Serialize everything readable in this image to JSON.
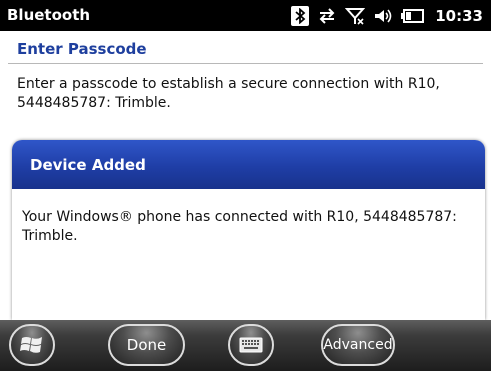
{
  "status_bar": {
    "app_title": "Bluetooth",
    "time": "10:33",
    "icons": [
      "bluetooth-icon",
      "sync-icon",
      "no-signal-icon",
      "speaker-icon",
      "battery-icon"
    ]
  },
  "page": {
    "heading": "Enter Passcode",
    "description": "Enter a passcode to establish a secure connection with R10, 5448485787: Trimble."
  },
  "dialog": {
    "title": "Device Added",
    "message": "Your Windows® phone has connected with R10, 5448485787: Trimble."
  },
  "taskbar": {
    "start_icon": "windows-logo-icon",
    "done_label": "Done",
    "keyboard_icon": "keyboard-icon",
    "advanced_label": "Advanced"
  },
  "colors": {
    "heading": "#1e3f9e",
    "dialog_title_bg": "#1f3ea6",
    "status_bar_bg": "#000000"
  }
}
